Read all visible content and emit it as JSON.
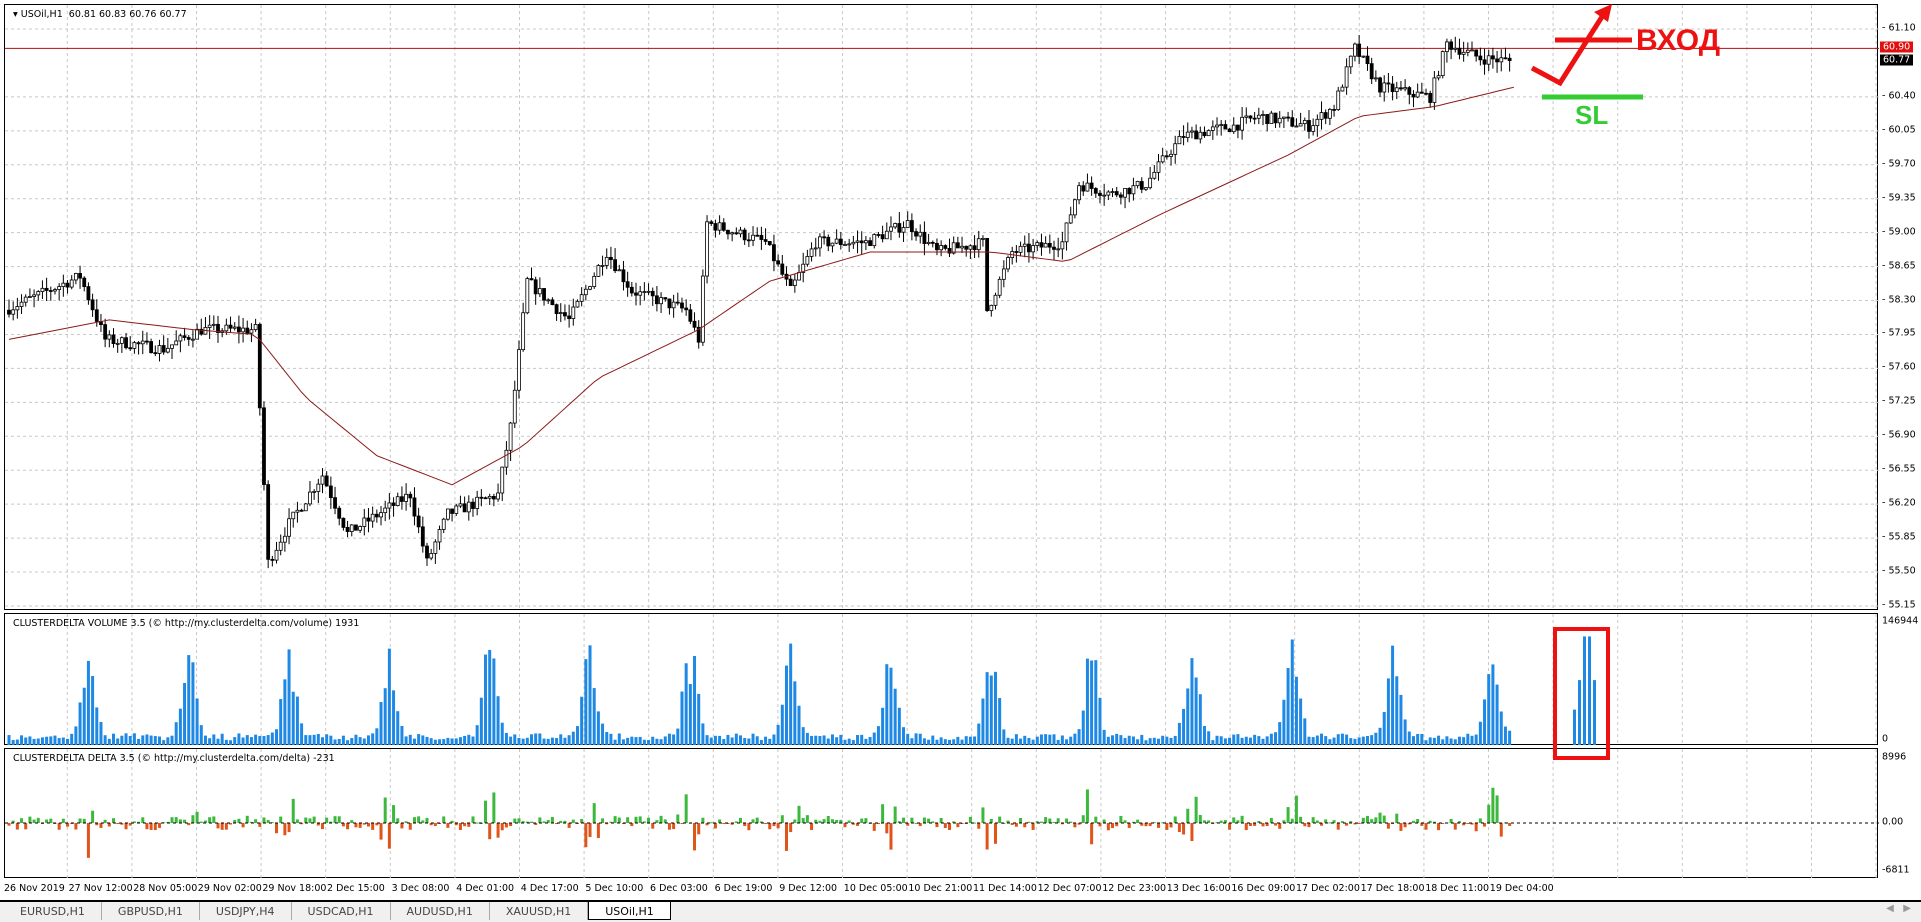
{
  "main": {
    "symbol_label": "USOil,H1",
    "ohlc": "60.81 60.83 60.76 60.77",
    "price_ticks": [
      "61.10",
      "60.40",
      "60.05",
      "59.70",
      "59.35",
      "59.00",
      "58.65",
      "58.30",
      "57.95",
      "57.60",
      "57.25",
      "56.90",
      "56.55",
      "56.20",
      "55.85",
      "55.50",
      "55.15"
    ],
    "level_tag": "60.90",
    "bid_tag": "60.77",
    "annotation_entry": "ВХОД",
    "annotation_sl": "SL"
  },
  "volume": {
    "label": "CLUSTERDELTA VOLUME 3.5 (© http://my.clusterdelta.com/volume) 1931",
    "max": "146944",
    "min": "0"
  },
  "delta": {
    "label": "CLUSTERDELTA DELTA 3.5 (© http://my.clusterdelta.com/delta) -231",
    "max": "8996",
    "zero": "0.00",
    "min": "-6811"
  },
  "dates": [
    "26 Nov 2019",
    "27 Nov 12:00",
    "28 Nov 05:00",
    "29 Nov 02:00",
    "29 Nov 18:00",
    "2 Dec 15:00",
    "3 Dec 08:00",
    "4 Dec 01:00",
    "4 Dec 17:00",
    "5 Dec 10:00",
    "6 Dec 03:00",
    "6 Dec 19:00",
    "9 Dec 12:00",
    "10 Dec 05:00",
    "10 Dec 21:00",
    "11 Dec 14:00",
    "12 Dec 07:00",
    "12 Dec 23:00",
    "13 Dec 16:00",
    "16 Dec 09:00",
    "17 Dec 02:00",
    "17 Dec 18:00",
    "18 Dec 11:00",
    "19 Dec 04:00"
  ],
  "tabs": [
    "EURUSD,H1",
    "GBPUSD,H1",
    "USDJPY,H4",
    "USDCAD,H1",
    "AUDUSD,H1",
    "XAUUSD,H1",
    "USOil,H1"
  ],
  "active_tab": "USOil,H1",
  "colors": {
    "bull": "#000000",
    "ma": "#8b1a1a",
    "volume": "#1e88e5",
    "delta_pos": "#3cb83c",
    "delta_neg": "#e0541a",
    "annotation_red": "#ee1111",
    "annotation_green": "#33cc33"
  },
  "chart_data": {
    "type": "candlestick",
    "bars": 360,
    "ylim": [
      55.15,
      61.2
    ],
    "close_path": [
      [
        0,
        58.2
      ],
      [
        18,
        58.55
      ],
      [
        24,
        57.9
      ],
      [
        38,
        57.8
      ],
      [
        47,
        58.0
      ],
      [
        60,
        58.0
      ],
      [
        62,
        56.4
      ],
      [
        63,
        55.6
      ],
      [
        68,
        56.0
      ],
      [
        76,
        56.5
      ],
      [
        82,
        55.9
      ],
      [
        97,
        56.3
      ],
      [
        101,
        55.6
      ],
      [
        106,
        56.1
      ],
      [
        118,
        56.3
      ],
      [
        121,
        57.0
      ],
      [
        125,
        58.5
      ],
      [
        135,
        58.1
      ],
      [
        144,
        58.8
      ],
      [
        150,
        58.4
      ],
      [
        163,
        58.2
      ],
      [
        166,
        57.9
      ],
      [
        168,
        59.1
      ],
      [
        182,
        58.9
      ],
      [
        188,
        58.4
      ],
      [
        194,
        58.9
      ],
      [
        206,
        58.9
      ],
      [
        216,
        59.1
      ],
      [
        223,
        58.8
      ],
      [
        234,
        58.9
      ],
      [
        235,
        58.2
      ],
      [
        241,
        58.8
      ],
      [
        253,
        58.9
      ],
      [
        257,
        59.5
      ],
      [
        265,
        59.4
      ],
      [
        273,
        59.5
      ],
      [
        278,
        59.8
      ],
      [
        282,
        60.0
      ],
      [
        294,
        60.1
      ],
      [
        300,
        60.2
      ],
      [
        312,
        60.1
      ],
      [
        318,
        60.3
      ],
      [
        323,
        60.9
      ],
      [
        329,
        60.5
      ],
      [
        341,
        60.4
      ],
      [
        345,
        60.95
      ],
      [
        353,
        60.8
      ],
      [
        360,
        60.77
      ]
    ],
    "ma_path": [
      [
        0,
        57.9
      ],
      [
        24,
        58.1
      ],
      [
        44,
        58.0
      ],
      [
        59,
        57.95
      ],
      [
        71,
        57.3
      ],
      [
        88,
        56.7
      ],
      [
        106,
        56.4
      ],
      [
        123,
        56.8
      ],
      [
        141,
        57.5
      ],
      [
        165,
        58.0
      ],
      [
        182,
        58.5
      ],
      [
        206,
        58.8
      ],
      [
        235,
        58.8
      ],
      [
        253,
        58.7
      ],
      [
        276,
        59.2
      ],
      [
        306,
        59.8
      ],
      [
        323,
        60.2
      ],
      [
        341,
        60.3
      ],
      [
        360,
        60.5
      ]
    ],
    "horizontal_level": 60.9
  }
}
